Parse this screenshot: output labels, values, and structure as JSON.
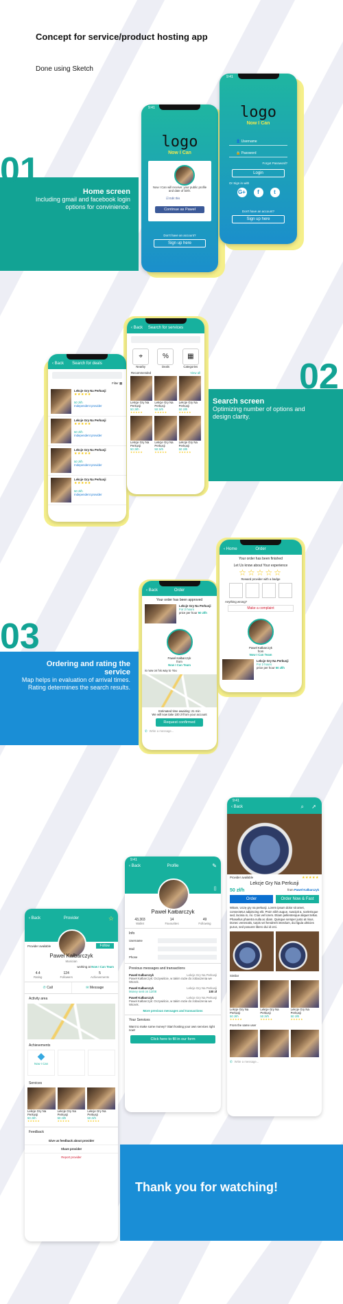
{
  "header": {
    "title": "Concept for service/product hosting app",
    "subtitle": "Done using Sketch"
  },
  "sections": [
    {
      "number": "01",
      "title": "Home screen",
      "desc": "Including gmail and facebook login options for convinience."
    },
    {
      "number": "02",
      "title": "Search screen",
      "desc": "Optimizing number of options and design clarity."
    },
    {
      "number": "03",
      "title": "Ordering and rating the service",
      "desc": "Map helps in evaluation of arrival times. Rating determines the search results."
    }
  ],
  "common": {
    "status_time": "9:41",
    "back": "Back",
    "logo": "logo",
    "tagline": "Now I Can",
    "lesson_title": "Lekcje Gry Na Perkusji",
    "price": "50 zł/h",
    "provider_name": "Paweł Kałbarczyk",
    "from_label": "from",
    "team": "Now I Can Team",
    "stars": "★★★★★"
  },
  "login_fb": {
    "prompt": "Now I Can will receive: your public profile and date of birth.",
    "edit": "Edit this",
    "continue": "Continue as Paweł",
    "no_account": "Don't have an account?",
    "signup": "Sign up here"
  },
  "login_form": {
    "username": "Username",
    "password": "Password",
    "forgot": "Forgot Password?",
    "login": "Login",
    "sign_in_with": "Or Sign in with",
    "socials": [
      "G+",
      "f",
      "t"
    ],
    "no_account": "Don't have an account?",
    "signup": "Sign up here"
  },
  "search_deals": {
    "title": "Search for deals",
    "filter": "Filter",
    "items": [
      {
        "title": "Lekcje Gry Na Perkusji",
        "price": "50 zł/h",
        "provider": "Independent provider"
      },
      {
        "title": "Lekcje Gry Na Perkusji",
        "price": "50 zł/h",
        "provider": "Independent provider"
      },
      {
        "title": "Lekcje Gry Na Perkusji",
        "price": "50 zł/h",
        "provider": "Independent provider"
      },
      {
        "title": "Lekcje Gry Na Perkusji",
        "price": "50 zł/h",
        "provider": "Independent provider"
      }
    ]
  },
  "search_services": {
    "title": "Search for services",
    "cats": [
      "Nearby",
      "Deals",
      "Categories"
    ],
    "recommended": "Recommended",
    "view_all": "View all"
  },
  "order": {
    "title": "Order",
    "approved": "Your order has been approved",
    "for_hours": "For 2 hours",
    "price_per_hour": "price per hour",
    "on_way": "is now on his way to You",
    "est_time": "Estimated time awaiting: 21 min",
    "take_time": "We will now take 100 zł from your account",
    "request_confirmed": "Request confirmed",
    "write_message": "Write a message..."
  },
  "finished": {
    "home": "Home",
    "title": "Order",
    "banner": "Your order has been finished",
    "rate": "Let Us know about Your experience",
    "badge": "Reward provider with a badge",
    "wrong": "Anything wrong?",
    "complaint": "Make a complaint",
    "for_hours": "For 2 hours",
    "price_per_hour": "price per hour"
  },
  "provider": {
    "title": "Provider",
    "available": "Provider available",
    "role": "Musician",
    "follow": "Follow",
    "working_at": "working at",
    "stats": [
      {
        "value": "4.4",
        "label": "Rating"
      },
      {
        "value": "124",
        "label": "Followers"
      },
      {
        "value": "5",
        "label": "Achievements"
      }
    ],
    "call": "Call",
    "message": "Message",
    "activity": "Activity area",
    "achievements": "Achievements",
    "badge_label": "Now I Can",
    "services": "Services",
    "feedback": "Feedback",
    "give_feedback": "Give us feedback about provider",
    "share": "Share provider",
    "report": "Report provider"
  },
  "profile": {
    "title": "Profile",
    "stats": [
      {
        "value": "43,303",
        "label": "Wallet"
      },
      {
        "value": "14",
        "label": "Favourites"
      },
      {
        "value": "49",
        "label": "Following"
      }
    ],
    "info": "Info",
    "fields": [
      "Username",
      "Mail",
      "Phone"
    ],
    "prev_title": "Previous messages and transactions",
    "messages": [
      {
        "name": "Paweł Kałbarczyk",
        "service": "Lekcje Gry Na Perkusji",
        "text": "Paweł Kałbarczyk: Oczywiście, w takim razie do zobaczenia we Wtorek."
      },
      {
        "name": "Paweł Kałbarczyk",
        "service": "Lekcje Gry Na Perkusji",
        "text": "Money sent on 12/08",
        "amount": "100 zł"
      },
      {
        "name": "Paweł Kałbarczyk",
        "service": "Lekcje Gry Na Perkusji",
        "text": "Paweł Kałbarczyk: Oczywiście, w takim razie do zobaczenia we Wtorek."
      }
    ],
    "more": "More previous messages and transactions",
    "your_services": "Your Services",
    "want_money": "Want to make some money? Start hosting your own services right now!",
    "fill_form": "Click here to fill in our form"
  },
  "detail": {
    "available": "Provider available",
    "from_provider": "from",
    "order": "Order",
    "order_fast": "Order Now & Fast",
    "desc": "Witam, Uczę gry na perkusji. Lorem ipsum dolor sit amet, consectetur adipiscing elit. Proin nibh augue, suscipit a, scelerisque sed, lacinia in, mi. Cras vel lorem. Etiam pellentesque aliquet tellus. Phasellus pharetra nulla ac diam. Quisque semper justo at risus. Donec venenatis, turpis vel hendrerit interdum, dui ligula ultricies purus, sed posuere libero dui id orci.",
    "similar": "Similar",
    "same_user": "From the same user",
    "write_message": "Write a message..."
  },
  "closing": "Thank you for watching!",
  "colors": {
    "teal": "#17b19e",
    "blue": "#1a8ed6",
    "yellow": "#f5ef8a",
    "bright_blue": "#0a6fd0"
  }
}
